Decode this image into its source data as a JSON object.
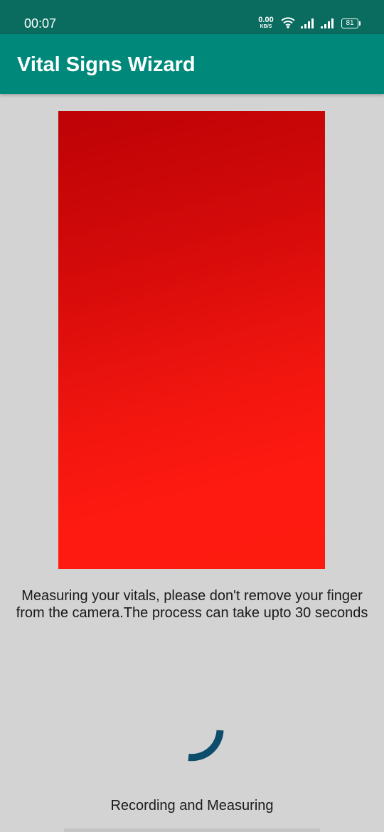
{
  "status_bar": {
    "time": "00:07",
    "net_speed_value": "0.00",
    "net_speed_unit": "KB/S",
    "battery": "81"
  },
  "app_bar": {
    "title": "Vital Signs Wizard"
  },
  "main": {
    "instructions": "Measuring your vitals, please don't remove your finger from the camera.The process can take upto 30 seconds",
    "status": "Recording and Measuring"
  },
  "icons": [
    "wifi-icon",
    "cell-signal-icon",
    "battery-icon",
    "loading-spinner-icon"
  ],
  "colors": {
    "status_bar": "#0a6b5f",
    "app_bar": "#00897b",
    "background": "#d3d3d3",
    "camera_top": "#bd0205",
    "camera_bottom": "#fe1a10",
    "spinner": "#0d4d6b"
  }
}
